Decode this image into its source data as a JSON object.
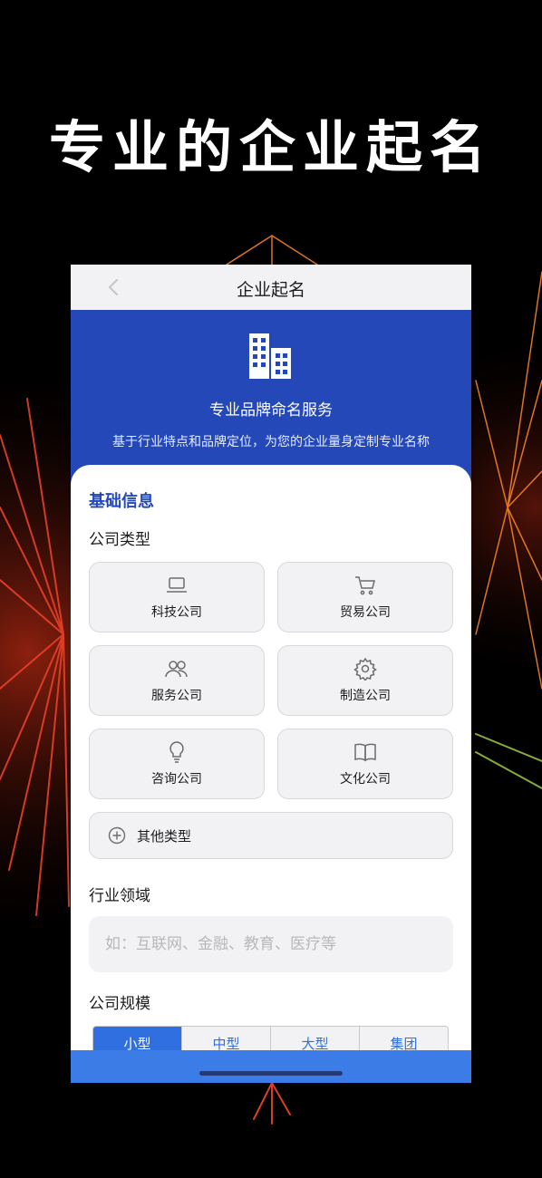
{
  "headline": "专业的企业起名",
  "nav": {
    "title": "企业起名",
    "back_icon": "chevron-left-icon"
  },
  "hero": {
    "icon": "buildings-icon",
    "title": "专业品牌命名服务",
    "subtitle": "基于行业特点和品牌定位，为您的企业量身定制专业名称"
  },
  "form": {
    "section_title": "基础信息",
    "company_type_label": "公司类型",
    "company_types": [
      {
        "label": "科技公司",
        "icon": "laptop-icon"
      },
      {
        "label": "贸易公司",
        "icon": "cart-icon"
      },
      {
        "label": "服务公司",
        "icon": "users-icon"
      },
      {
        "label": "制造公司",
        "icon": "gear-icon"
      },
      {
        "label": "咨询公司",
        "icon": "lightbulb-icon"
      },
      {
        "label": "文化公司",
        "icon": "book-icon"
      }
    ],
    "other_type": {
      "label": "其他类型",
      "icon": "plus-circle-icon"
    },
    "industry_label": "行业领域",
    "industry_placeholder": "如：互联网、金融、教育、医疗等",
    "size_label": "公司规模",
    "sizes": [
      "小型",
      "中型",
      "大型",
      "集团"
    ],
    "selected_size": "小型"
  },
  "colors": {
    "hero_blue": "#2448b8",
    "accent_blue": "#2f6fe0",
    "bottom_bar": "#3b7ce6",
    "card_bg": "#f2f2f4"
  }
}
